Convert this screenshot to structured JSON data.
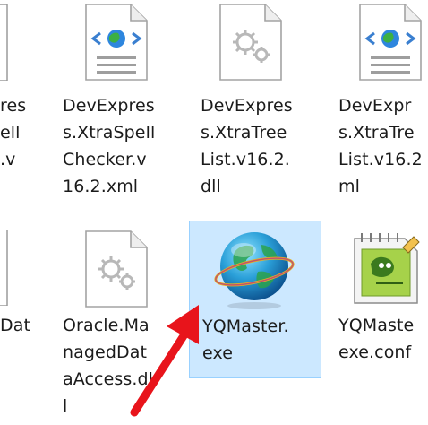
{
  "window": {
    "background": "#ffffff",
    "selection_fill": "#cce8ff",
    "selection_border": "#99d1ff"
  },
  "files": [
    {
      "name_lines": [
        "res",
        "ell",
        ".v"
      ],
      "icon": "file-icon-partial",
      "selected": false
    },
    {
      "name_lines": [
        "DevExpres",
        "s.XtraSpell",
        "Checker.v",
        "16.2.xml"
      ],
      "icon": "xml-document-icon",
      "selected": false
    },
    {
      "name_lines": [
        "DevExpres",
        "s.XtraTree",
        "List.v16.2.",
        "dll"
      ],
      "icon": "dll-gear-document-icon",
      "selected": false
    },
    {
      "name_lines": [
        "DevExpr",
        "s.XtraTre",
        "List.v16.2",
        "ml"
      ],
      "icon": "xml-document-icon",
      "selected": false
    },
    {
      "name_lines": [
        "Dat"
      ],
      "icon": "file-icon-partial",
      "selected": false
    },
    {
      "name_lines": [
        "Oracle.Ma",
        "nagedDat",
        "aAccess.dl",
        "l"
      ],
      "icon": "dll-gear-document-icon",
      "selected": false
    },
    {
      "name_lines": [
        "YQMaster.",
        "exe"
      ],
      "icon": "globe-app-icon",
      "selected": true
    },
    {
      "name_lines": [
        "YQMaste",
        "exe.conf"
      ],
      "icon": "notepad-plus-config-icon",
      "selected": false
    }
  ],
  "annotation": {
    "arrow_color": "#e8141b",
    "points_to": "YQMaster.exe"
  }
}
